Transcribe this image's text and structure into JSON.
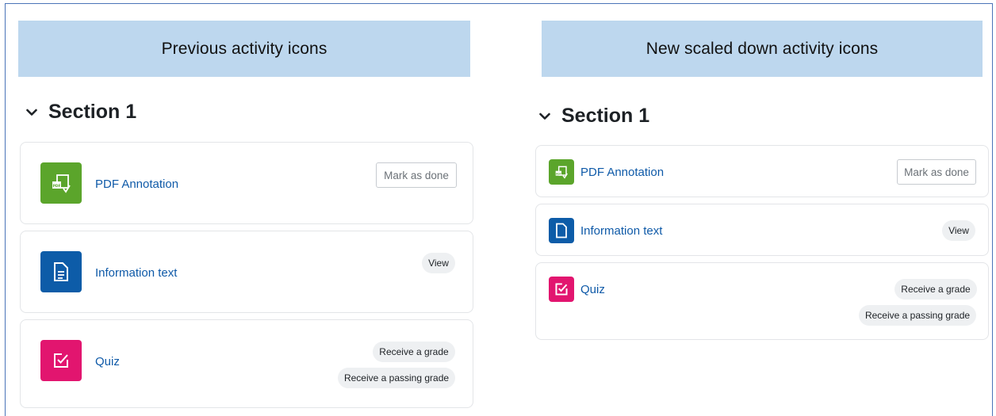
{
  "left": {
    "banner": "Previous activity icons",
    "section_title": "Section 1",
    "activities": [
      {
        "name": "PDF Annotation",
        "action": "Mark as done",
        "icon": "pdf-annotation-icon",
        "color": "#5ba52b"
      },
      {
        "name": "Information text",
        "action": "View",
        "icon": "page-icon",
        "color": "#0d5ca8"
      },
      {
        "name": "Quiz",
        "conditions": [
          "Receive a grade",
          "Receive a passing grade"
        ],
        "icon": "quiz-icon",
        "color": "#e2156f"
      }
    ]
  },
  "right": {
    "banner": "New scaled down activity icons",
    "section_title": "Section 1",
    "activities": [
      {
        "name": "PDF Annotation",
        "action": "Mark as done",
        "icon": "pdf-annotation-icon",
        "color": "#5ba52b"
      },
      {
        "name": "Information text",
        "action": "View",
        "icon": "page-icon",
        "color": "#0d5ca8"
      },
      {
        "name": "Quiz",
        "conditions": [
          "Receive a grade",
          "Receive a passing grade"
        ],
        "icon": "quiz-icon",
        "color": "#e2156f"
      }
    ]
  },
  "colors": {
    "banner_bg": "#bdd7ee",
    "frame_border": "#4a74b8",
    "link": "#0f5aa8"
  }
}
